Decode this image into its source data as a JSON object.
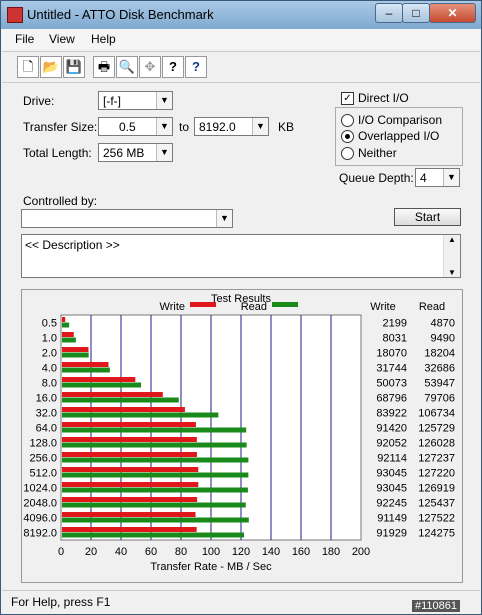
{
  "window": {
    "title": "Untitled - ATTO Disk Benchmark",
    "min_label": "–",
    "max_label": "□",
    "close_label": "✕"
  },
  "menu": [
    "File",
    "View",
    "Help"
  ],
  "toolbar": {
    "icons": [
      "new-file-icon",
      "open-folder-icon",
      "save-icon",
      "print-icon",
      "print-preview-icon",
      "move-icon",
      "help-icon",
      "context-help-icon"
    ],
    "glyphs": [
      "🗋",
      "📂",
      "💾",
      "🖶",
      "🔍",
      "✥",
      "?",
      "?"
    ]
  },
  "form": {
    "drive_label": "Drive:",
    "drive_value": "[-f-]",
    "transfer_size_label": "Transfer Size:",
    "transfer_from": "0.5",
    "to_label": "to",
    "transfer_to": "8192.0",
    "kb_label": "KB",
    "total_length_label": "Total Length:",
    "total_length_value": "256 MB",
    "direct_io_label": "Direct I/O",
    "direct_io_checked": true,
    "io_comparison_label": "I/O Comparison",
    "overlapped_io_label": "Overlapped I/O",
    "neither_label": "Neither",
    "selected_mode": "Overlapped I/O",
    "queue_depth_label": "Queue Depth:",
    "queue_depth_value": "4",
    "controlled_by_label": "Controlled by:",
    "controlled_by_value": "",
    "start_label": "Start",
    "description_text": "<< Description >>"
  },
  "status": {
    "help_text": "For Help, press F1",
    "watermark": "#110861"
  },
  "colors": {
    "write": "#e0171b",
    "read": "#1a8a1a",
    "grid_line": "#1c1c8c"
  },
  "chart_data": {
    "type": "bar",
    "title": "Test Results",
    "legend": [
      "Write",
      "Read"
    ],
    "legend_placement": "top",
    "categories": [
      "0.5",
      "1.0",
      "2.0",
      "4.0",
      "8.0",
      "16.0",
      "32.0",
      "64.0",
      "128.0",
      "256.0",
      "512.0",
      "1024.0",
      "2048.0",
      "4096.0",
      "8192.0"
    ],
    "series": [
      {
        "name": "Write",
        "values": [
          2199,
          8031,
          18070,
          31744,
          50073,
          68796,
          83922,
          91420,
          92052,
          92114,
          93045,
          93045,
          92245,
          91149,
          91929
        ]
      },
      {
        "name": "Read",
        "values": [
          4870,
          9490,
          18204,
          32686,
          53947,
          79706,
          106734,
          125729,
          126028,
          127237,
          127220,
          126919,
          125437,
          127522,
          124275
        ]
      }
    ],
    "table_headers": [
      "Write",
      "Read"
    ],
    "xlabel": "Transfer Rate - MB / Sec",
    "xticks": [
      "0",
      "20",
      "40",
      "60",
      "80",
      "100",
      "120",
      "140",
      "160",
      "180",
      "200"
    ],
    "xlim": [
      0,
      200
    ],
    "orientation": "horizontal",
    "grid": true
  }
}
